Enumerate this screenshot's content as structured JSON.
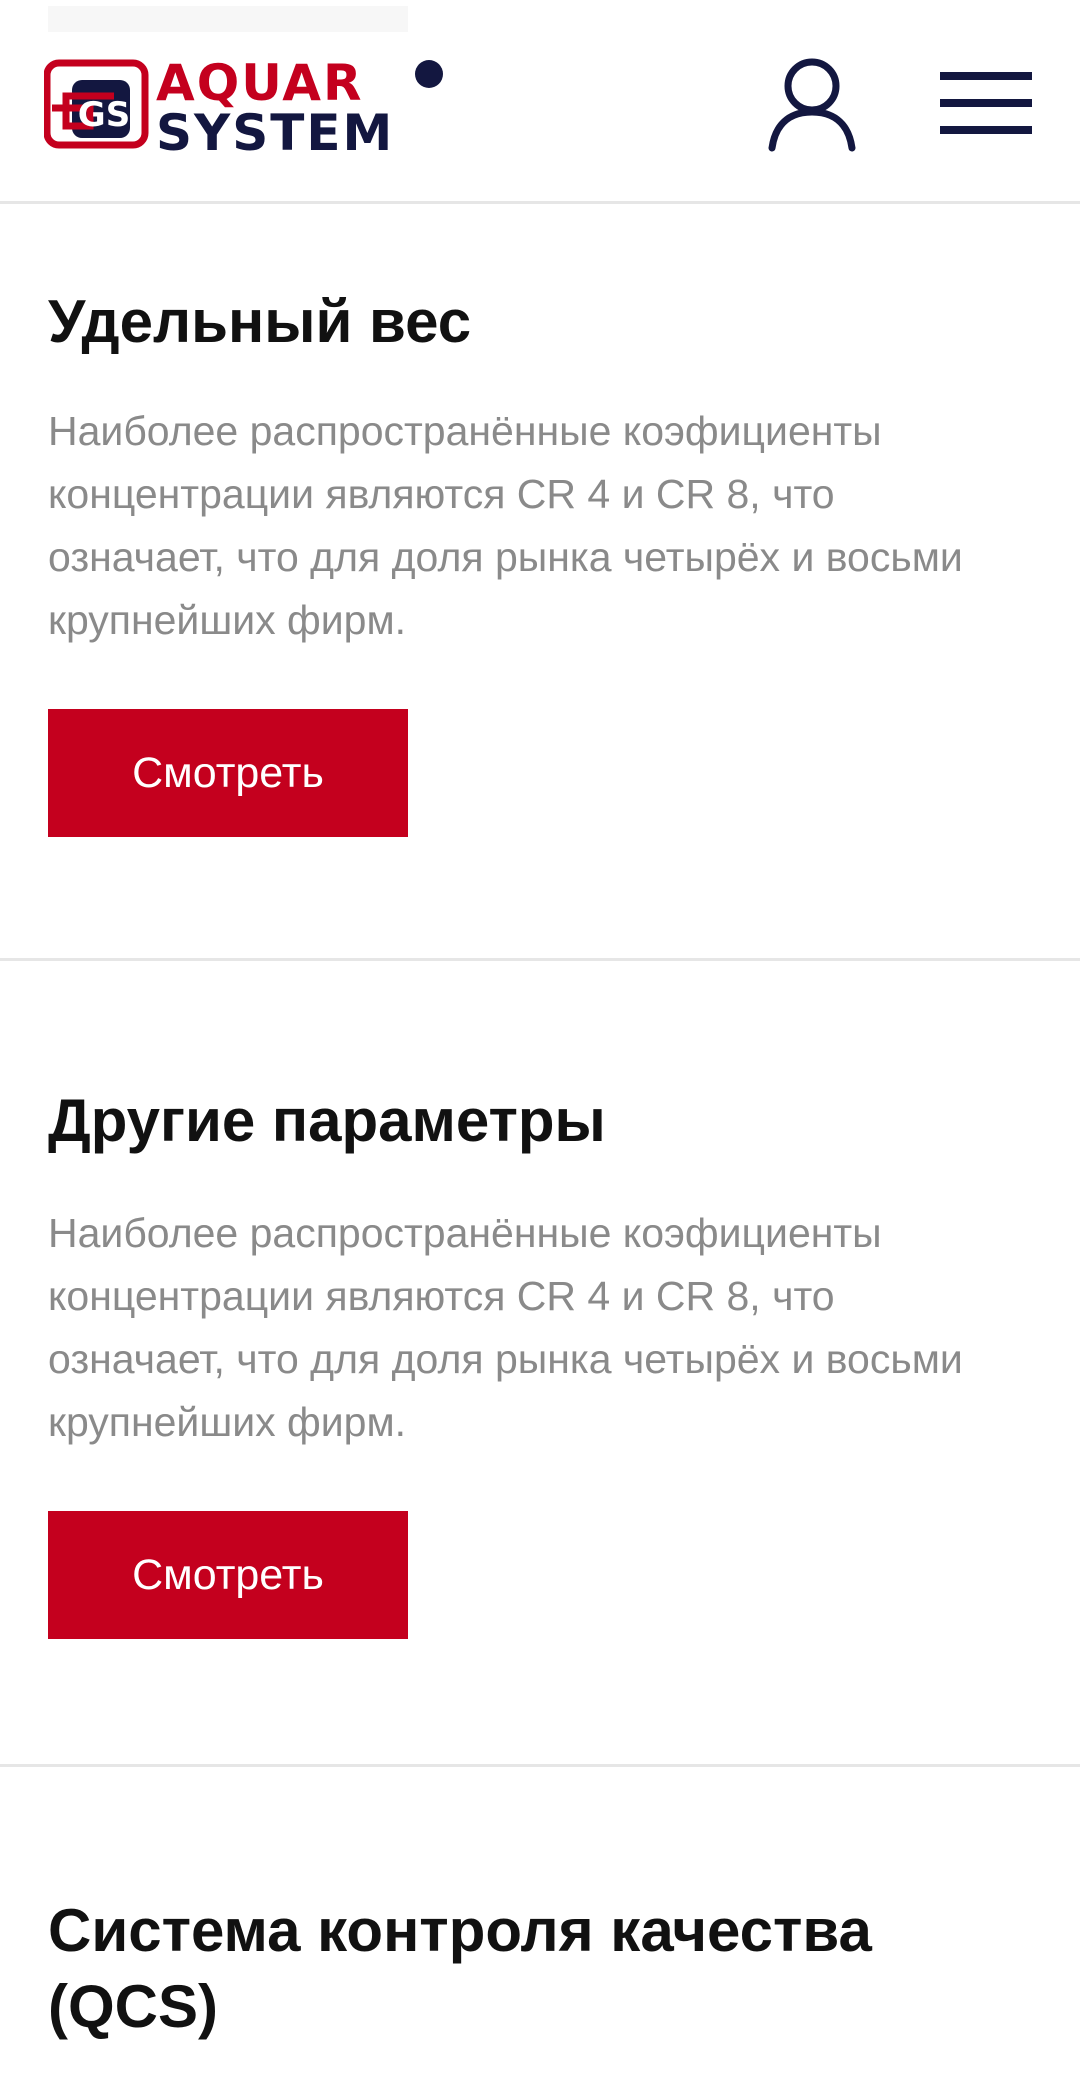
{
  "header": {
    "logo": {
      "line1": "AQUAR",
      "line2": "SYSTEM",
      "monogram": "GS",
      "colors": {
        "red": "#c4001e",
        "navy": "#131740"
      }
    },
    "user_icon": "user-icon",
    "menu_icon": "hamburger-menu-icon"
  },
  "sections": [
    {
      "title": "Удельный вес",
      "description": "Наиболее распространённые коэфициенты концентрации являются CR 4 и CR 8, что означает, что для доля рынка четырёх и восьми крупнейших фирм.",
      "button_label": "Смотреть"
    },
    {
      "title": "Другие параметры",
      "description": "Наиболее распространённые коэфициенты концентрации являются CR 4 и CR 8, что означает, что для доля рынка четырёх и восьми крупнейших фирм.",
      "button_label": "Смотреть"
    },
    {
      "title": "Система контроля качества (QCS)"
    }
  ],
  "theme": {
    "accent": "#c4001e",
    "navy": "#131740",
    "text_muted": "#8a8a8a",
    "divider": "#e6e6e6"
  }
}
